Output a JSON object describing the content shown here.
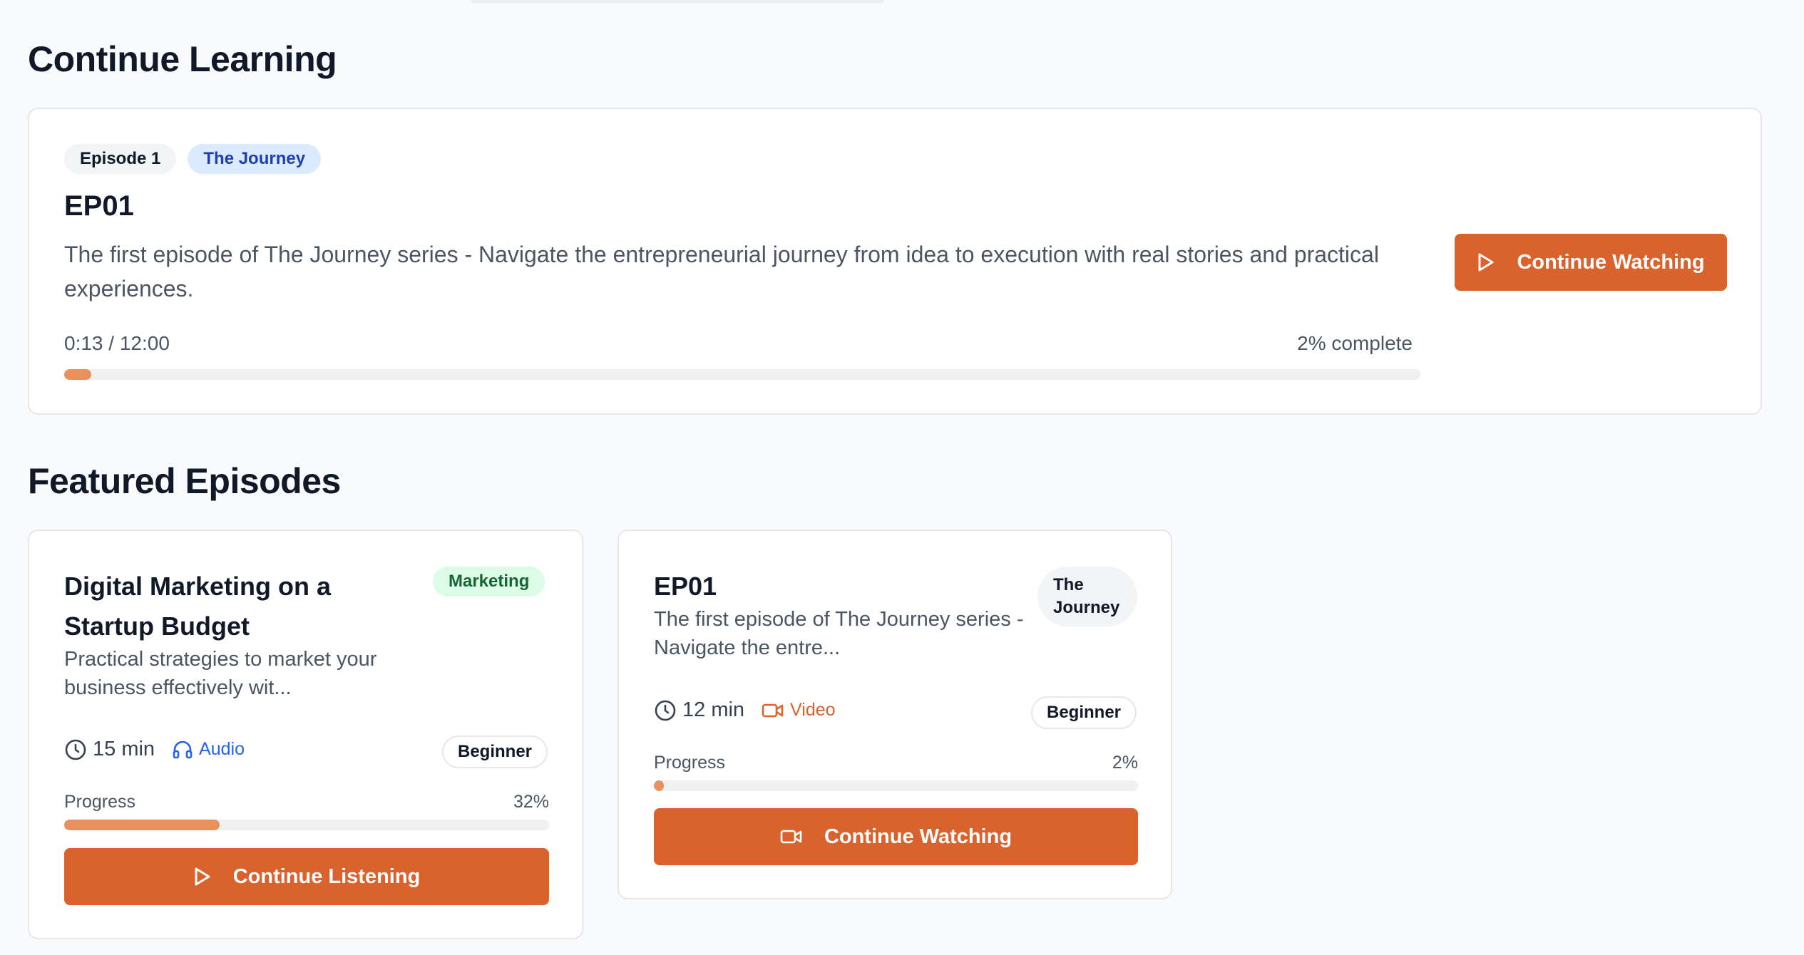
{
  "continue_learning": {
    "title": "Continue Learning",
    "episode_badge": "Episode 1",
    "series_badge": "The Journey",
    "episode_title": "EP01",
    "description": "The first episode of The Journey series - Navigate the entrepreneurial journey from idea to execution with real stories and practical experiences.",
    "time_text": "0:13 / 12:00",
    "complete_text": "2% complete",
    "progress": 0.02,
    "button_label": "Continue Watching",
    "button_icon": "play-icon"
  },
  "featured": {
    "title": "Featured Episodes",
    "cards": [
      {
        "title": "Digital Marketing on a Startup Budget",
        "category": "Marketing",
        "description": "Practical strategies to market your business effectively wit...",
        "duration": "15 min",
        "media_type": "Audio",
        "media_icon": "headphones-icon",
        "level": "Beginner",
        "progress_label": "Progress",
        "progress_text": "32%",
        "progress": 0.32,
        "button_label": "Continue Listening",
        "button_icon": "play-icon"
      },
      {
        "title": "EP01",
        "category": "The Journey",
        "description": "The first episode of The Journey series - Navigate the entre...",
        "duration": "12 min",
        "media_type": "Video",
        "media_icon": "video-icon",
        "level": "Beginner",
        "progress_label": "Progress",
        "progress_text": "2%",
        "progress": 0.02,
        "button_label": "Continue Watching",
        "button_icon": "video-icon"
      }
    ]
  },
  "colors": {
    "accent": "#d9622d",
    "progress_fill": "#e8915f",
    "audio": "#2563eb",
    "video": "#d9622d"
  }
}
